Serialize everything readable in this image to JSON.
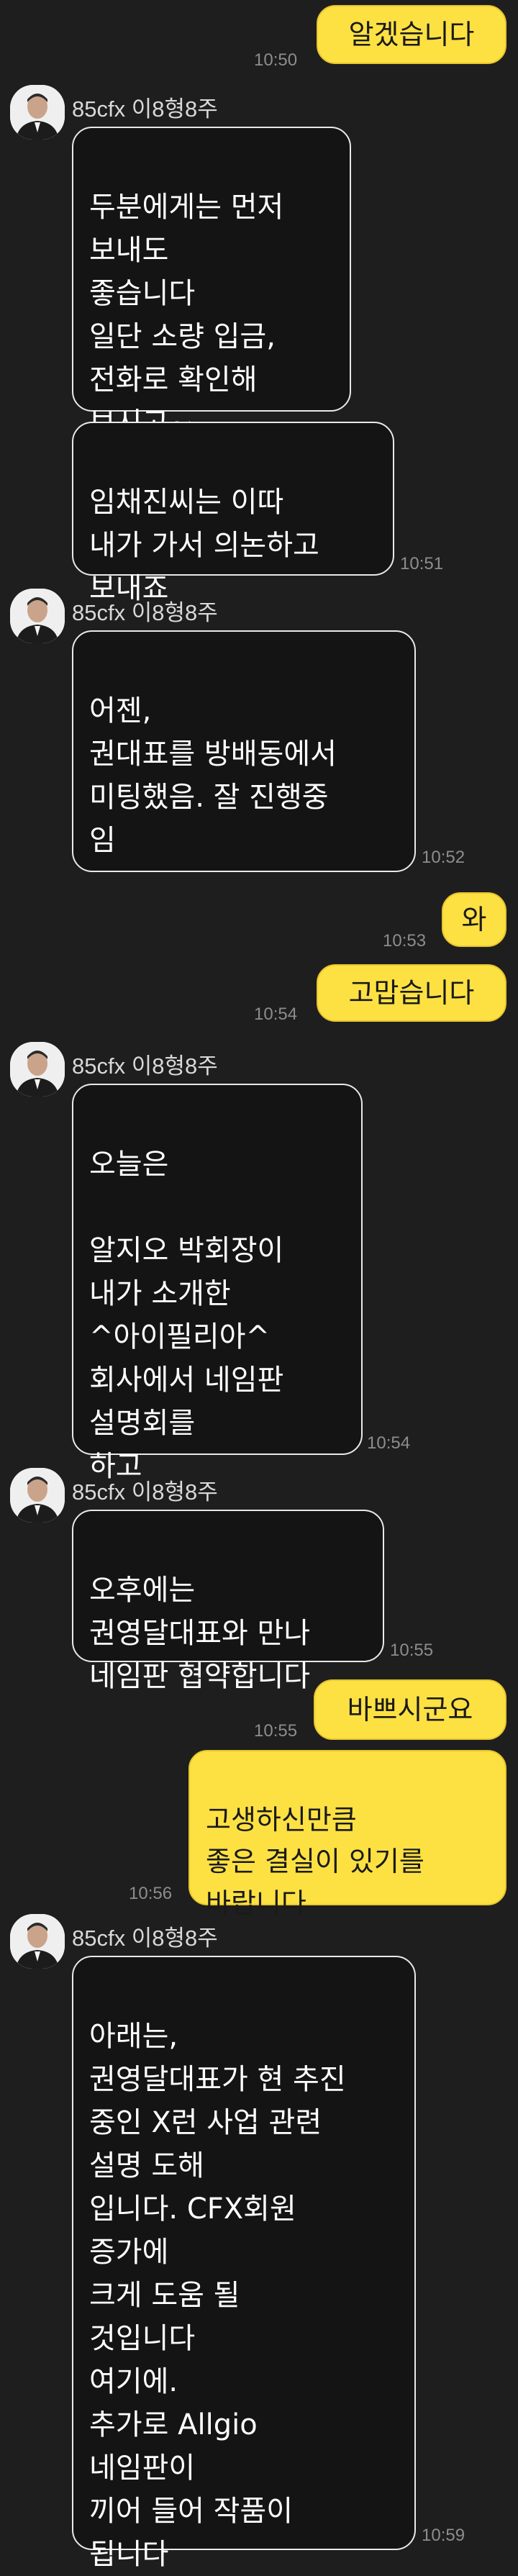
{
  "colors": {
    "background": "#1e1e1e",
    "outgoing_bubble": "#fde143",
    "incoming_bubble": "#141414",
    "timestamp": "#8d8d8d"
  },
  "sender_name": "85cfx 이8형8주",
  "messages": [
    {
      "dir": "out",
      "text": "알겠습니다",
      "time": "10:50"
    },
    {
      "dir": "in",
      "text": "두분에게는 먼저\n보내도\n좋습니다\n일단 소량 입금,\n전화로 확인해\n보시고~",
      "time": ""
    },
    {
      "dir": "in",
      "text": "임채진씨는 이따\n내가 가서 의논하고\n보내죠",
      "time": "10:51"
    },
    {
      "dir": "in",
      "text": "어젠,\n권대표를 방배동에서\n미팅했음. 잘 진행중\n임",
      "time": "10:52"
    },
    {
      "dir": "out",
      "text": "와",
      "time": "10:53"
    },
    {
      "dir": "out",
      "text": "고맙습니다",
      "time": "10:54"
    },
    {
      "dir": "in",
      "text": "오늘은\n\n알지오 박회장이\n내가 소개한\n^아이필리아^\n회사에서 네임판\n설명회를\n하고",
      "time": "10:54"
    },
    {
      "dir": "in",
      "text": "오후에는\n권영달대표와 만나\n네임판 협약합니다",
      "time": "10:55"
    },
    {
      "dir": "out",
      "text": "바쁘시군요",
      "time": "10:55"
    },
    {
      "dir": "out",
      "text": "고생하신만큼\n좋은 결실이 있기를\n바랍니다",
      "time": "10:56"
    },
    {
      "dir": "in",
      "text": "아래는,\n권영달대표가 현 추진\n중인 X런 사업 관련\n설명 도해\n입니다.  CFX회원\n증가에\n크게 도움 될\n것입니다\n여기에.\n추가로 Allgio\n네임판이\n끼어 들어 작품이\n됩니다",
      "time": "10:59"
    }
  ]
}
